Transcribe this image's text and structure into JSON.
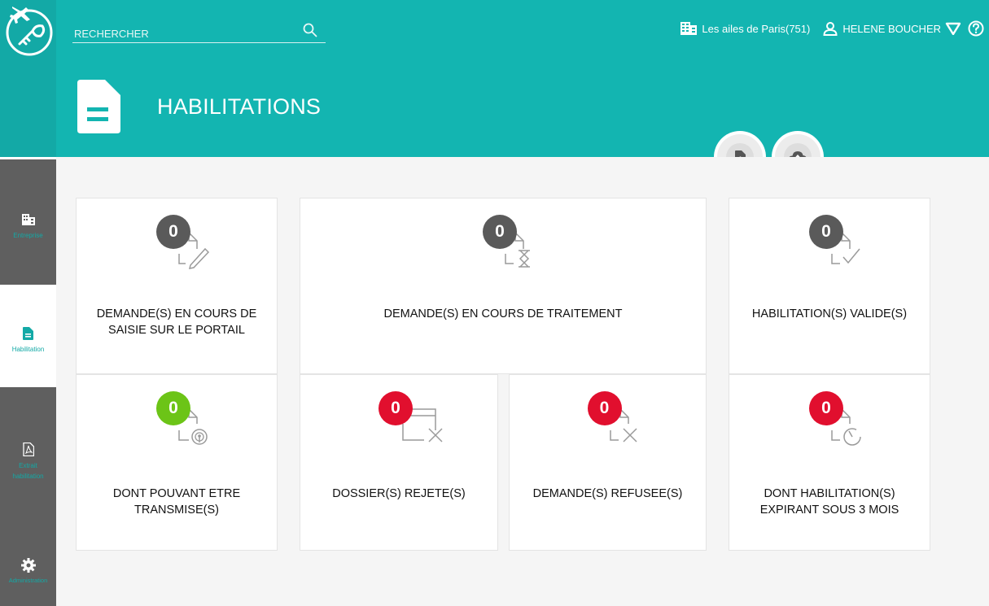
{
  "sidebar": {
    "items": [
      {
        "label": "Entreprise",
        "icon": "building-icon"
      },
      {
        "label": "Habilitation",
        "icon": "document-icon"
      },
      {
        "label": "Extrait habilitation",
        "icon": "pdf-icon"
      },
      {
        "label": "Administration",
        "icon": "gear-icon"
      }
    ]
  },
  "header": {
    "search_placeholder": "RECHERCHER",
    "company": "Les ailes de Paris(751)",
    "user": "HELENE BOUCHER",
    "page_title": "HABILITATIONS"
  },
  "colors": {
    "teal": "#13b5b1",
    "sidebar_dark": "#5f5f5f",
    "badge_gray": "#5a5a5a",
    "badge_green": "#6cc417",
    "badge_red": "#e10f2e"
  },
  "cards": [
    {
      "count": "0",
      "label": "DEMANDE(S) EN COURS DE SAISIE SUR LE PORTAIL",
      "status": "gray",
      "icon": "document-pencil-icon"
    },
    {
      "count": "0",
      "label": "DEMANDE(S) EN COURS DE TRAITEMENT",
      "status": "gray",
      "icon": "document-hourglass-icon"
    },
    {
      "count": "0",
      "label": "HABILITATION(S) VALIDE(S)",
      "status": "gray",
      "icon": "document-check-icon"
    },
    {
      "count": "0",
      "label": "DONT POUVANT ETRE TRANSMISE(S)",
      "status": "green",
      "icon": "document-broadcast-icon"
    },
    {
      "count": "0",
      "label": "DOSSIER(S) REJETE(S)",
      "status": "red",
      "icon": "folder-x-icon"
    },
    {
      "count": "0",
      "label": "DEMANDE(S) REFUSEE(S)",
      "status": "red",
      "icon": "document-x-icon"
    },
    {
      "count": "0",
      "label": "DONT HABILITATION(S) EXPIRANT SOUS 3 MOIS",
      "status": "red",
      "icon": "document-timer-icon"
    }
  ]
}
